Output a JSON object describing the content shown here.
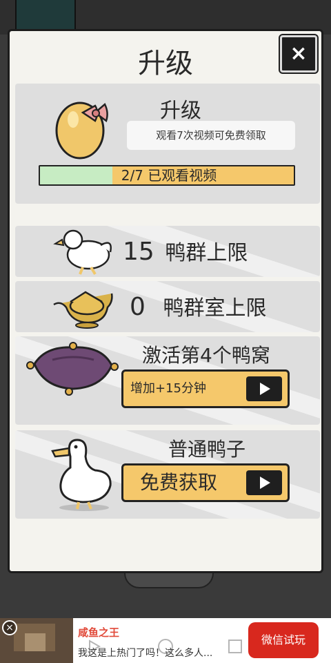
{
  "dialog": {
    "title": "升级",
    "close_label": "×"
  },
  "upgrade": {
    "label": "升级",
    "watch_hint": "观看7次视频可免费领取",
    "progress_text": "2/7 已观看视频",
    "progress_fraction": 0.2857
  },
  "rows": [
    {
      "number": "15",
      "label": "鸭群上限"
    },
    {
      "number": "0",
      "label": "鸭群室上限"
    }
  ],
  "nest": {
    "title": "激活第4个鸭窝",
    "button_label": "增加+15分钟"
  },
  "duck": {
    "title": "普通鸭子",
    "button_label": "免费获取"
  },
  "ad": {
    "close_label": "×",
    "title": "咸鱼之王",
    "description": "我这是上热门了吗！这么多人...",
    "button_label": "微信试玩"
  },
  "colors": {
    "accent_yellow": "#f5c86b",
    "progress_green": "#c7ecc3",
    "ad_red": "#d8281e"
  }
}
